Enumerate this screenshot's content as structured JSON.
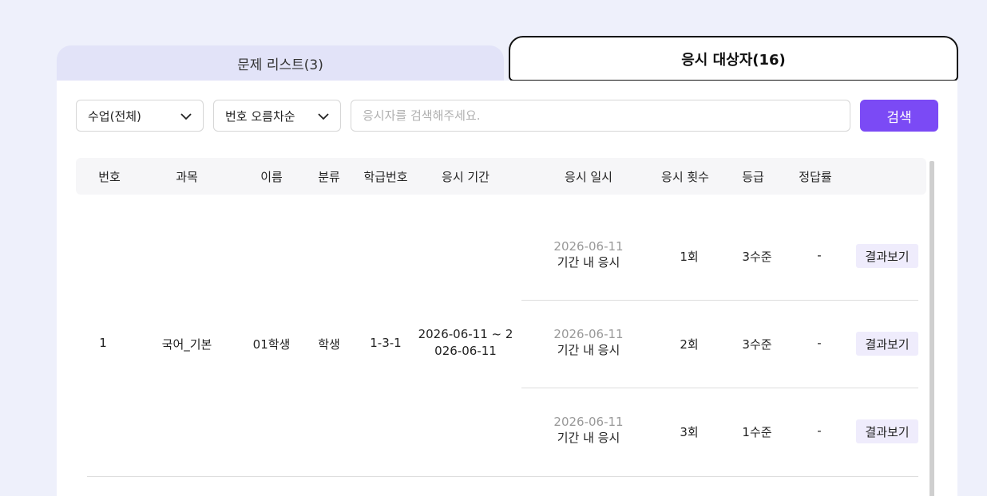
{
  "tabs": {
    "problem_list": "문제 리스트(3)",
    "examinees": "응시 대상자(16)"
  },
  "filters": {
    "class_select": "수업(전체)",
    "sort_select": "번호 오름차순",
    "search_placeholder": "응시자를 검색해주세요.",
    "search_button": "검색"
  },
  "table": {
    "headers": {
      "number": "번호",
      "subject": "과목",
      "name": "이름",
      "category": "분류",
      "class_number": "학급번호",
      "exam_period": "응시 기간",
      "exam_datetime": "응시 일시",
      "attempt_count": "응시 횟수",
      "grade": "등급",
      "accuracy": "정답률"
    },
    "student": {
      "number": "1",
      "subject": "국어_기본",
      "name": "01학생",
      "category": "학생",
      "class_number": "1-3-1",
      "period_line1": "2026-06-11 ~ 2",
      "period_line2": "026-06-11"
    },
    "attempts": [
      {
        "date": "2026-06-11",
        "status": "기간 내 응시",
        "count": "1회",
        "grade": "3수준",
        "accuracy": "-",
        "action": "결과보기"
      },
      {
        "date": "2026-06-11",
        "status": "기간 내 응시",
        "count": "2회",
        "grade": "3수준",
        "accuracy": "-",
        "action": "결과보기"
      },
      {
        "date": "2026-06-11",
        "status": "기간 내 응시",
        "count": "3회",
        "grade": "1수준",
        "accuracy": "-",
        "action": "결과보기"
      }
    ]
  }
}
